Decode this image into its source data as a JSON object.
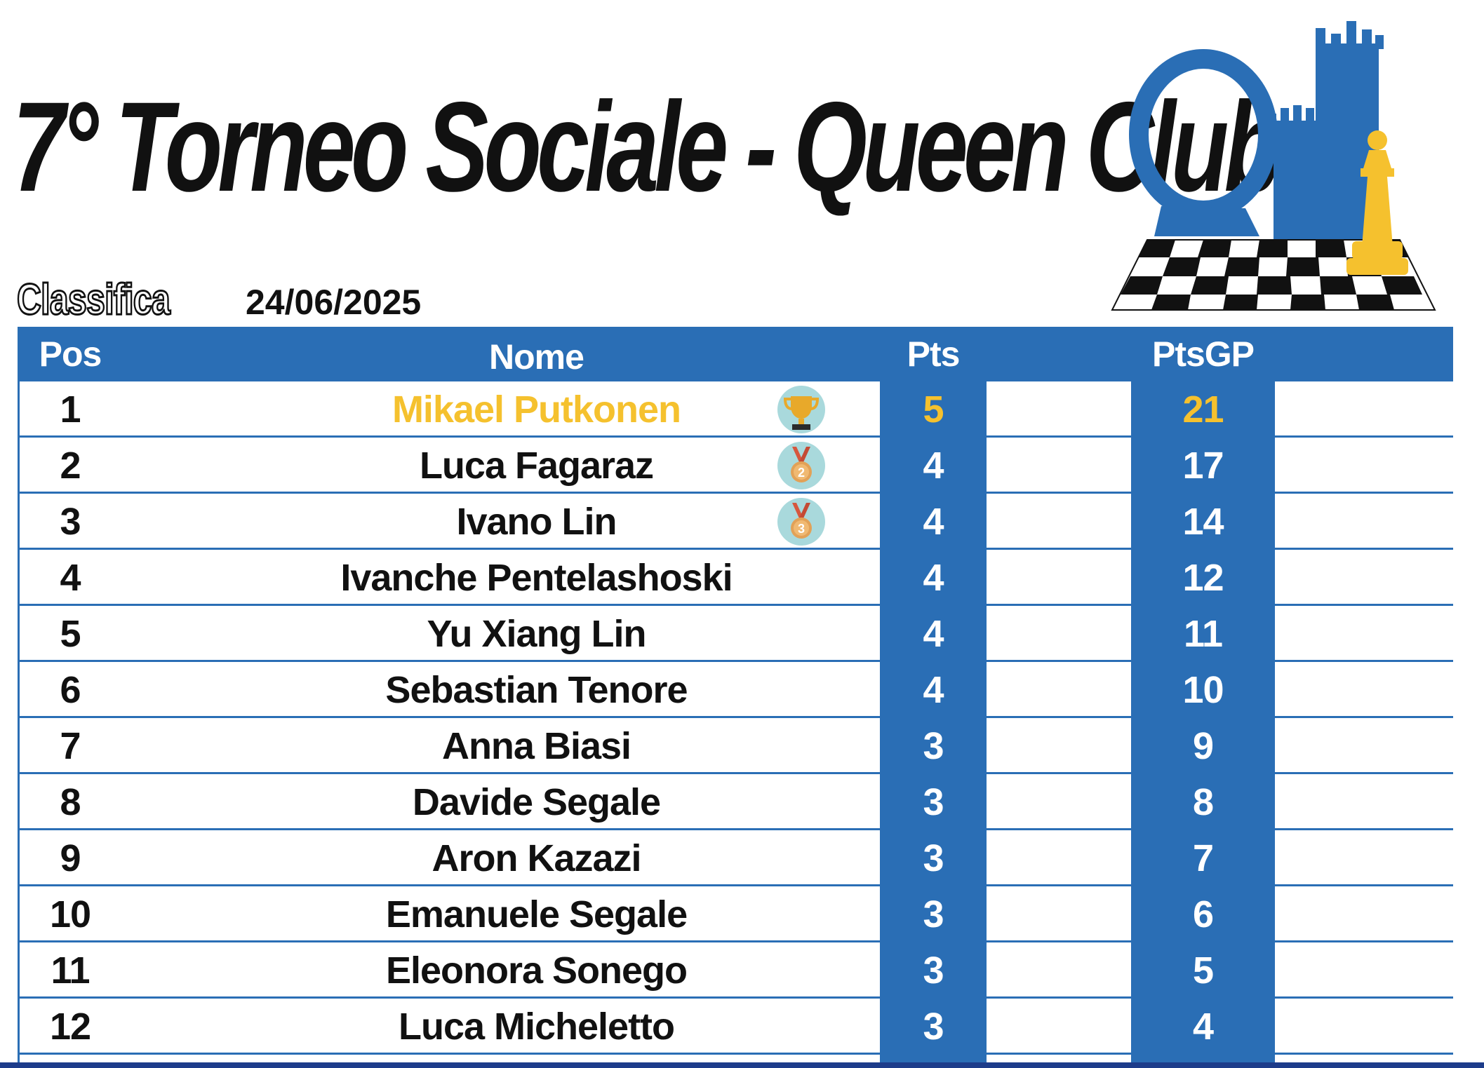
{
  "header": {
    "title": "7° Torneo Sociale - Queen Club",
    "section": "Classifica",
    "date": "24/06/2025"
  },
  "colors": {
    "accent": "#2a6eb5",
    "leader_highlight": "#f5c12e"
  },
  "logo": {
    "icon": "queen-club-logo"
  },
  "table": {
    "columns": [
      "Pos",
      "Nome",
      "Pts",
      "PtsGP"
    ],
    "rows": [
      {
        "pos": "1",
        "name": "Mikael Putkonen",
        "pts": "5",
        "ptsgp": "21",
        "award": "trophy-icon"
      },
      {
        "pos": "2",
        "name": "Luca Fagaraz",
        "pts": "4",
        "ptsgp": "17",
        "award": "silver-medal-icon"
      },
      {
        "pos": "3",
        "name": "Ivano Lin",
        "pts": "4",
        "ptsgp": "14",
        "award": "bronze-medal-icon"
      },
      {
        "pos": "4",
        "name": "Ivanche Pentelashoski",
        "pts": "4",
        "ptsgp": "12"
      },
      {
        "pos": "5",
        "name": "Yu Xiang Lin",
        "pts": "4",
        "ptsgp": "11"
      },
      {
        "pos": "6",
        "name": "Sebastian Tenore",
        "pts": "4",
        "ptsgp": "10"
      },
      {
        "pos": "7",
        "name": "Anna Biasi",
        "pts": "3",
        "ptsgp": "9"
      },
      {
        "pos": "8",
        "name": "Davide Segale",
        "pts": "3",
        "ptsgp": "8"
      },
      {
        "pos": "9",
        "name": "Aron Kazazi",
        "pts": "3",
        "ptsgp": "7"
      },
      {
        "pos": "10",
        "name": "Emanuele Segale",
        "pts": "3",
        "ptsgp": "6"
      },
      {
        "pos": "11",
        "name": "Eleonora Sonego",
        "pts": "3",
        "ptsgp": "5"
      },
      {
        "pos": "12",
        "name": "Luca Micheletto",
        "pts": "3",
        "ptsgp": "4"
      }
    ]
  }
}
